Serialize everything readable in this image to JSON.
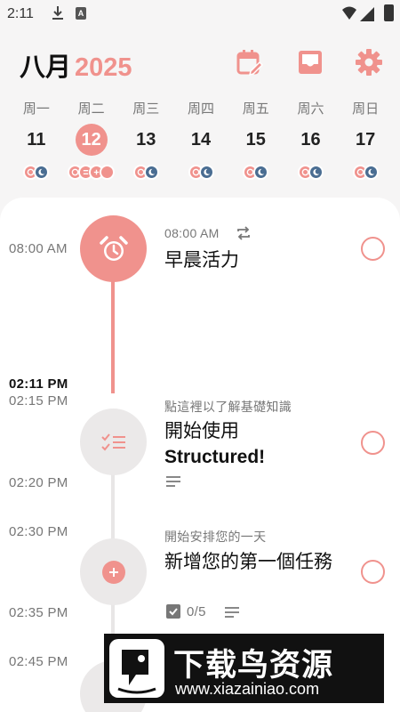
{
  "status_bar": {
    "time": "2:11",
    "icons": [
      "download-icon",
      "a-icon",
      "wifi-icon",
      "signal-icon",
      "battery-icon"
    ]
  },
  "header": {
    "month": "八月",
    "year": "2025",
    "buttons": [
      "calendar-edit-icon",
      "inbox-icon",
      "gear-icon"
    ]
  },
  "week": [
    {
      "name": "周一",
      "num": "11",
      "selected": false
    },
    {
      "name": "周二",
      "num": "12",
      "selected": true
    },
    {
      "name": "周三",
      "num": "13",
      "selected": false
    },
    {
      "name": "周四",
      "num": "14",
      "selected": false
    },
    {
      "name": "周五",
      "num": "15",
      "selected": false
    },
    {
      "name": "周六",
      "num": "16",
      "selected": false
    },
    {
      "name": "周日",
      "num": "17",
      "selected": false
    }
  ],
  "timeline": {
    "times": {
      "t1": "08:00 AM",
      "now": "02:11 PM",
      "t2": "02:15 PM",
      "t3": "02:20 PM",
      "t4": "02:30 PM",
      "t5": "02:35 PM",
      "t6": "02:45 PM"
    },
    "tasks": [
      {
        "subtitle": "08:00 AM",
        "title": "早晨活力",
        "icon": "alarm-clock-icon",
        "repeat_icon": "repeat-icon"
      },
      {
        "subtitle": "點這裡以了解基礎知識",
        "title_line1": "開始使用",
        "title_line2": "Structured!",
        "icon": "checklist-icon"
      },
      {
        "subtitle": "開始安排您的一天",
        "title": "新增您的第一個任務",
        "icon": "add-icon",
        "subtasks": "0/5"
      }
    ]
  },
  "watermark": {
    "text": "下载鸟资源",
    "url": "www.xiazainiao.com"
  },
  "colors": {
    "accent": "#f0928d",
    "night": "#4a6d92",
    "rail": "#e8e6e6"
  }
}
